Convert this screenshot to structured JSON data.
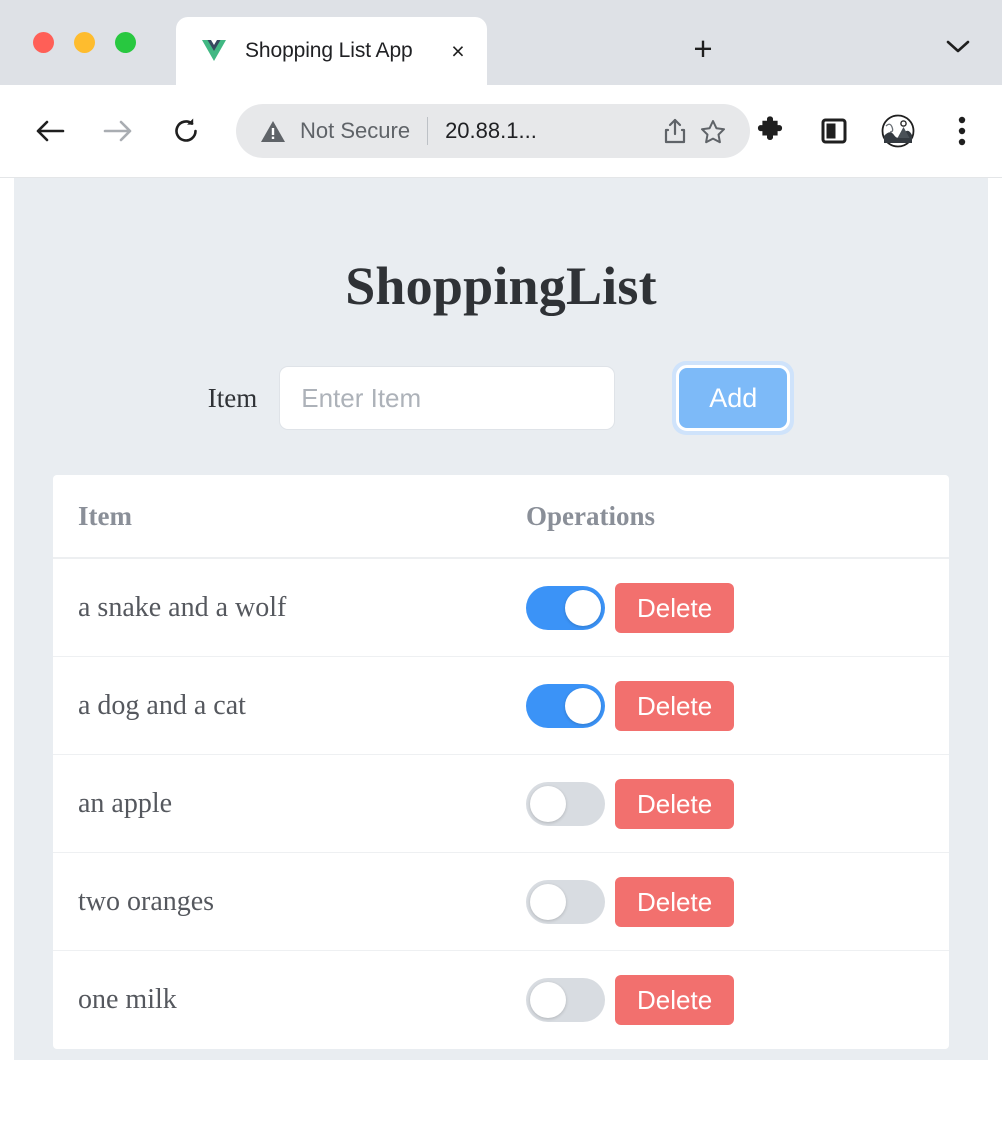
{
  "browser": {
    "tab": {
      "title": "Shopping List App",
      "favicon": "vue-logo-icon",
      "close_label": "×"
    },
    "new_tab_label": "+",
    "tab_list_icon": "chevron-down-icon",
    "toolbar": {
      "back_icon": "back-arrow-icon",
      "forward_icon": "forward-arrow-icon",
      "reload_icon": "reload-icon",
      "security_status": "Not Secure",
      "url": "20.88.1...",
      "share_icon": "share-icon",
      "bookmark_icon": "star-icon",
      "extensions_icon": "puzzle-piece-icon",
      "side_panel_icon": "side-panel-icon",
      "profile_icon": "avatar-icon",
      "menu_icon": "three-dot-menu-icon"
    }
  },
  "app": {
    "title": "ShoppingList",
    "form": {
      "label": "Item",
      "placeholder": "Enter Item",
      "value": "",
      "add_label": "Add"
    },
    "table": {
      "headers": {
        "item": "Item",
        "operations": "Operations"
      },
      "delete_label": "Delete",
      "rows": [
        {
          "name": "a snake and a wolf",
          "done": true
        },
        {
          "name": "a dog and a cat",
          "done": true
        },
        {
          "name": "an apple",
          "done": false
        },
        {
          "name": "two oranges",
          "done": false
        },
        {
          "name": "one milk",
          "done": false
        }
      ]
    }
  },
  "colors": {
    "page_bg": "#e9edf1",
    "toggle_on": "#3b93f7",
    "toggle_off": "#d8dce1",
    "delete": "#f2706e",
    "add": "#7dbaf8"
  }
}
